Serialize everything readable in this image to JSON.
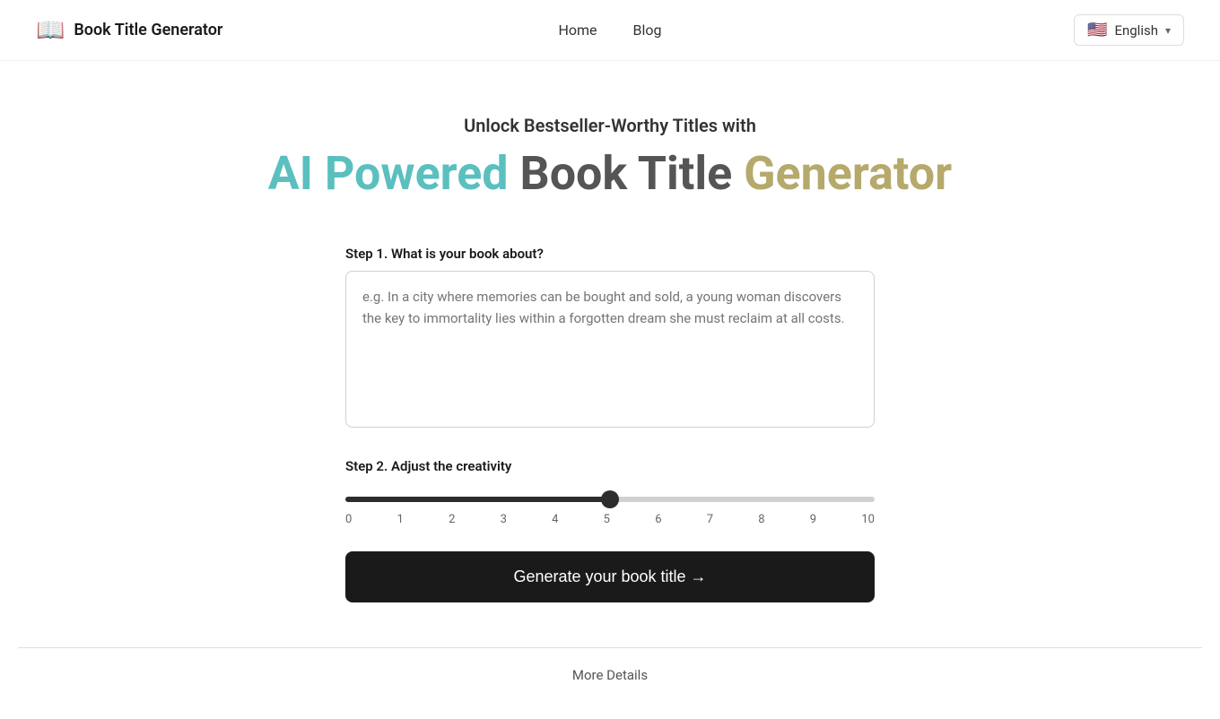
{
  "header": {
    "logo_icon": "📖",
    "site_title": "Book Title Generator",
    "nav": {
      "home": "Home",
      "blog": "Blog"
    },
    "language": {
      "flag": "🇺🇸",
      "label": "English"
    }
  },
  "hero": {
    "subtitle": "Unlock Bestseller-Worthy Titles with",
    "heading": {
      "part1": "AI Powered",
      "part2": "Book Title",
      "part3": "Generator"
    }
  },
  "form": {
    "step1_label": "Step 1. What is your book about?",
    "textarea_placeholder": "e.g. In a city where memories can be bought and sold, a young woman discovers the key to immortality lies within a forgotten dream she must reclaim at all costs.",
    "step2_label": "Step 2. Adjust the creativity",
    "slider": {
      "min": 0,
      "max": 10,
      "value": 5,
      "ticks": [
        "0",
        "1",
        "2",
        "3",
        "4",
        "5",
        "6",
        "7",
        "8",
        "9",
        "10"
      ]
    },
    "generate_button": "Generate your book title →",
    "more_details": "More Details"
  }
}
